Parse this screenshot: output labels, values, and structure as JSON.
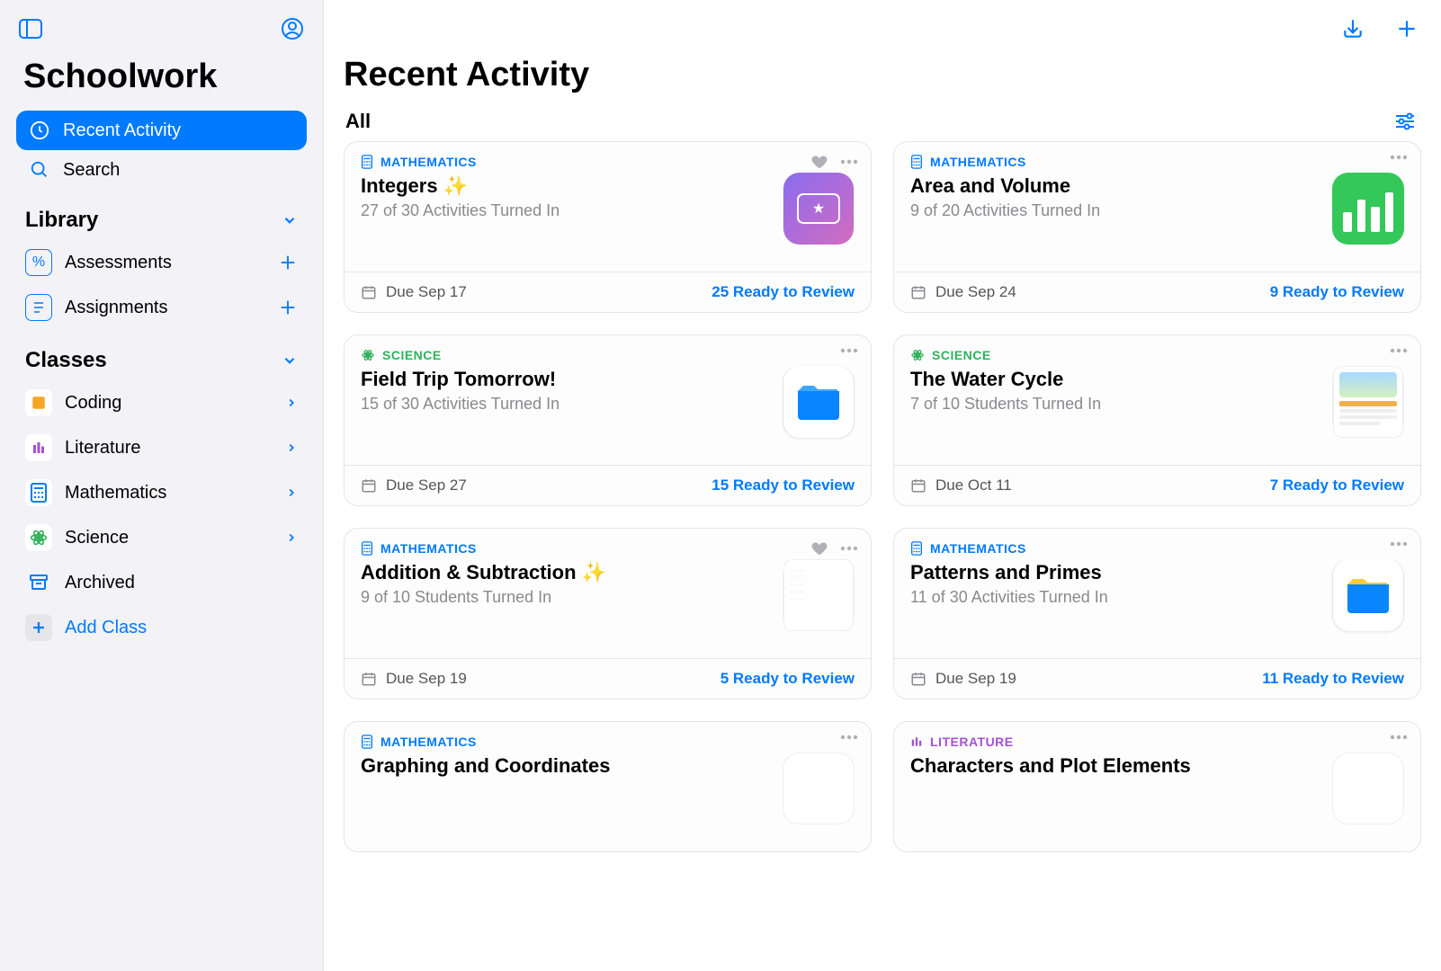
{
  "app": {
    "title": "Schoolwork"
  },
  "sidebar": {
    "nav": [
      {
        "label": "Recent Activity",
        "selected": true
      },
      {
        "label": "Search",
        "selected": false
      }
    ],
    "library": {
      "header": "Library",
      "items": [
        {
          "label": "Assessments"
        },
        {
          "label": "Assignments"
        }
      ]
    },
    "classes": {
      "header": "Classes",
      "items": [
        {
          "label": "Coding",
          "color": "#f5a623"
        },
        {
          "label": "Literature",
          "color": "#a450d6"
        },
        {
          "label": "Mathematics",
          "color": "#007aff"
        },
        {
          "label": "Science",
          "color": "#30b15a"
        }
      ],
      "archived": "Archived",
      "add": "Add Class"
    }
  },
  "main": {
    "title": "Recent Activity",
    "filter": "All",
    "cards": [
      {
        "subject": "MATHEMATICS",
        "subjectClass": "math",
        "title": "Integers ✨",
        "sub": "27 of 30 Activities Turned In",
        "due": "Due Sep 17",
        "review": "25 Ready to Review",
        "liked": true
      },
      {
        "subject": "MATHEMATICS",
        "subjectClass": "math",
        "title": "Area and Volume",
        "sub": "9 of 20 Activities Turned In",
        "due": "Due Sep 24",
        "review": "9 Ready to Review",
        "liked": false
      },
      {
        "subject": "SCIENCE",
        "subjectClass": "science",
        "title": "Field Trip Tomorrow!",
        "sub": "15 of 30 Activities Turned In",
        "due": "Due Sep 27",
        "review": "15 Ready to Review",
        "liked": false
      },
      {
        "subject": "SCIENCE",
        "subjectClass": "science",
        "title": "The Water Cycle",
        "sub": "7 of 10 Students Turned In",
        "due": "Due Oct 11",
        "review": "7 Ready to Review",
        "liked": false
      },
      {
        "subject": "MATHEMATICS",
        "subjectClass": "math",
        "title": "Addition & Subtraction ✨",
        "sub": "9 of 10 Students Turned In",
        "due": "Due Sep 19",
        "review": "5 Ready to Review",
        "liked": true
      },
      {
        "subject": "MATHEMATICS",
        "subjectClass": "math",
        "title": "Patterns and Primes",
        "sub": "11 of 30 Activities Turned In",
        "due": "Due Sep 19",
        "review": "11 Ready to Review",
        "liked": false
      },
      {
        "subject": "MATHEMATICS",
        "subjectClass": "math",
        "title": "Graphing and Coordinates",
        "sub": "",
        "due": "",
        "review": "",
        "liked": false
      },
      {
        "subject": "LITERATURE",
        "subjectClass": "literature",
        "title": "Characters and Plot Elements",
        "sub": "",
        "due": "",
        "review": "",
        "liked": false
      }
    ]
  }
}
